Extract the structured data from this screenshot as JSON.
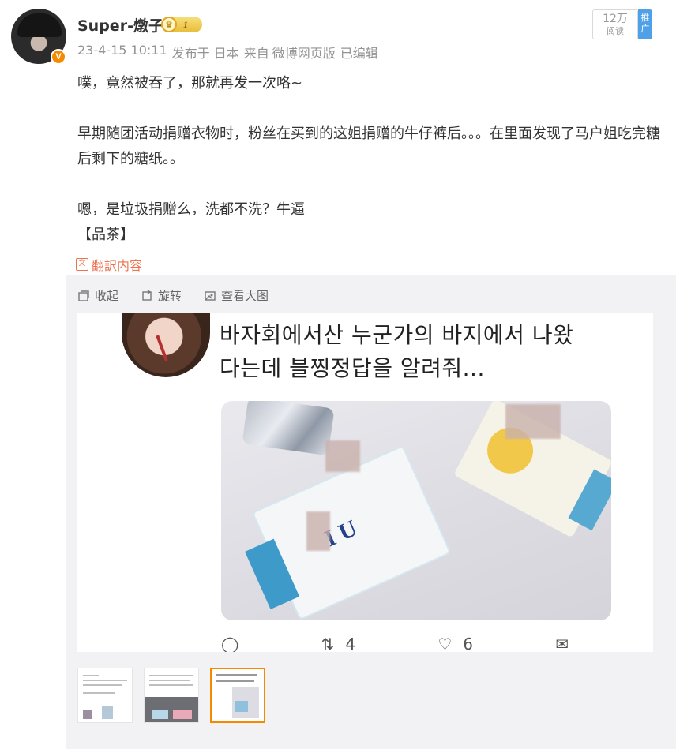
{
  "user": {
    "name": "Super-燉子",
    "level": "1",
    "verified_badge": "V"
  },
  "meta": {
    "time": "23-4-15 10:11",
    "posted_in": "发布于 日本",
    "source_prefix": "来自",
    "source": "微博网页版",
    "edited": "已编辑"
  },
  "stats": {
    "reads": "12万",
    "reads_label": "阅读",
    "ad_label": "推广"
  },
  "post": {
    "line1": "噗，竟然被吞了，那就再发一次咯~",
    "line2": "早期随团活动捐赠衣物时，粉丝在买到的这姐捐赠的牛仔裤后。。。在里面发现了马户姐吃完糖后剩下的糖纸。。",
    "line3": "嗯，是垃圾捐赠么，洗都不洗？牛逼",
    "line4": "【品茶】"
  },
  "translate": {
    "label": "翻訳内容"
  },
  "toolbar": {
    "collapse": "收起",
    "rotate": "旋转",
    "view_large": "查看大图"
  },
  "image": {
    "korean_line1": "바자회에서산 누군가의 바지에서 나왔",
    "korean_line2": "다는데 블찡정답을 알려줘...",
    "wrapper_text": "I U",
    "retweet_count": "4",
    "like_count": "6"
  },
  "thumbnails": {
    "count": 3,
    "active_index": 2
  },
  "colors": {
    "accent": "#eb7350",
    "meta": "#939393",
    "active_thumb": "#f58a00",
    "ad_blue": "#4fa0e8"
  }
}
